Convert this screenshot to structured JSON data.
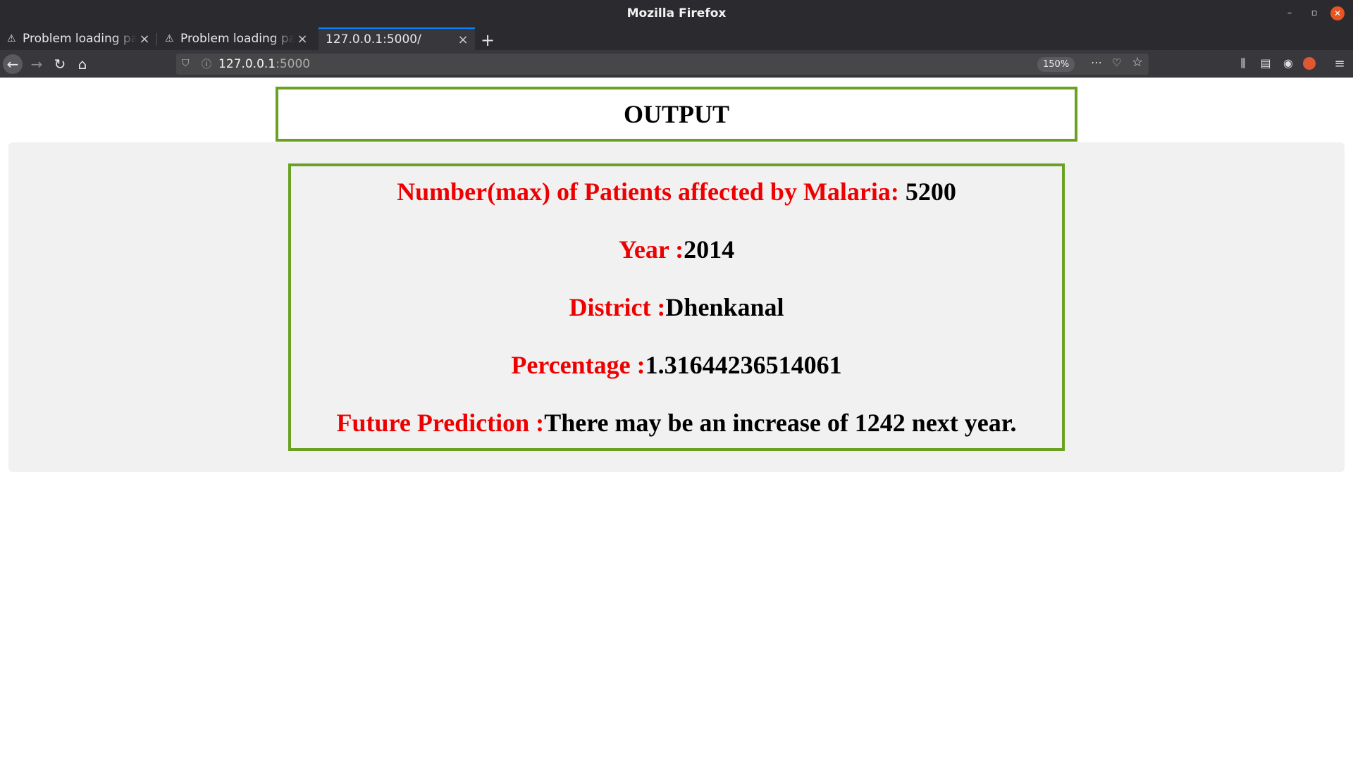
{
  "window": {
    "title": "Mozilla Firefox",
    "controls": {
      "minimize": "–",
      "maximize": "▫",
      "close": "✕"
    }
  },
  "tabs": [
    {
      "label": "Problem loading page",
      "icon": "warning-icon",
      "active": false
    },
    {
      "label": "Problem loading page",
      "icon": "warning-icon",
      "active": false
    },
    {
      "label": "127.0.0.1:5000/",
      "icon": "",
      "active": true
    }
  ],
  "toolbar": {
    "url_host": "127.0.0.1",
    "url_port": ":5000",
    "zoom": "150%",
    "accent": "#0a84ff"
  },
  "page": {
    "header_title": "OUTPUT",
    "border_color": "#6aa121",
    "label_color": "#ee0000",
    "rows": {
      "patients": {
        "label": "Number(max) of Patients affected by Malaria:",
        "value": " 5200"
      },
      "year": {
        "label": "Year :",
        "value": "2014"
      },
      "district": {
        "label": "District :",
        "value": "Dhenkanal"
      },
      "percentage": {
        "label": "Percentage :",
        "value": "1.31644236514061"
      },
      "prediction": {
        "label": "Future Prediction :",
        "value": "There may be an increase of 1242 next year."
      }
    }
  }
}
